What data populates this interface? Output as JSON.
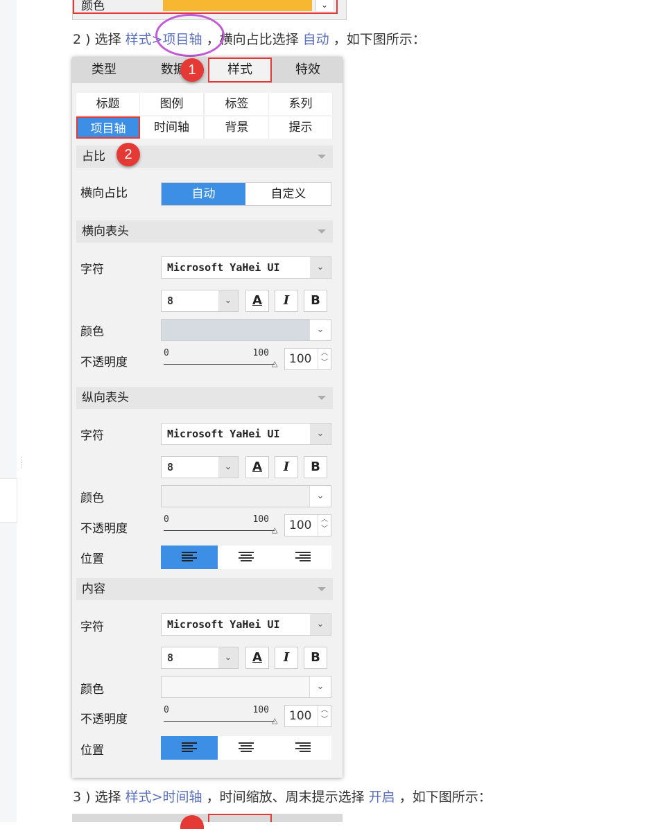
{
  "top_fragment": {
    "label": "颜色",
    "swatch_color": "#f7b731"
  },
  "step2": {
    "prefix": "2 ) 选择 ",
    "link1": "样式>项目轴",
    "mid": " ，横向占比选择 ",
    "link2": "自动",
    "suffix": " ，如下图所示："
  },
  "step3": {
    "prefix": "3 ) 选择 ",
    "link1": "样式>时间轴",
    "mid": " ，时间缩放、周末提示选择 ",
    "link2": "开启",
    "suffix": " ，如下图所示："
  },
  "main_tabs": [
    "类型",
    "数据",
    "样式",
    "特效"
  ],
  "sub_tabs": [
    "标题",
    "图例",
    "标签",
    "系列",
    "项目轴",
    "时间轴",
    "背景",
    "提示"
  ],
  "badges": [
    "1",
    "2"
  ],
  "proportion": {
    "section": "占比",
    "label": "横向占比",
    "options": [
      "自动",
      "自定义"
    ]
  },
  "h_header": {
    "section": "横向表头",
    "font_label": "字符",
    "font": "Microsoft YaHei UI",
    "size": "8",
    "color_label": "颜色",
    "color_fill": "#d6dbe1",
    "opacity_label": "不透明度",
    "min": "0",
    "max": "100",
    "value": "100"
  },
  "v_header": {
    "section": "纵向表头",
    "font_label": "字符",
    "font": "Microsoft YaHei UI",
    "size": "8",
    "color_label": "颜色",
    "color_fill": "#f0f0f0",
    "opacity_label": "不透明度",
    "min": "0",
    "max": "100",
    "value": "100",
    "position_label": "位置"
  },
  "content": {
    "section": "内容",
    "font_label": "字符",
    "font": "Microsoft YaHei UI",
    "size": "8",
    "color_label": "颜色",
    "color_fill": "#f7f7f7",
    "opacity_label": "不透明度",
    "min": "0",
    "max": "100",
    "value": "100",
    "position_label": "位置"
  },
  "format_buttons": {
    "color": "A",
    "italic": "I",
    "bold": "B"
  },
  "colors": {
    "accent": "#3d8fe6",
    "highlight": "#e53935",
    "link": "#5a6fbf",
    "circle": "#c35bd6"
  }
}
